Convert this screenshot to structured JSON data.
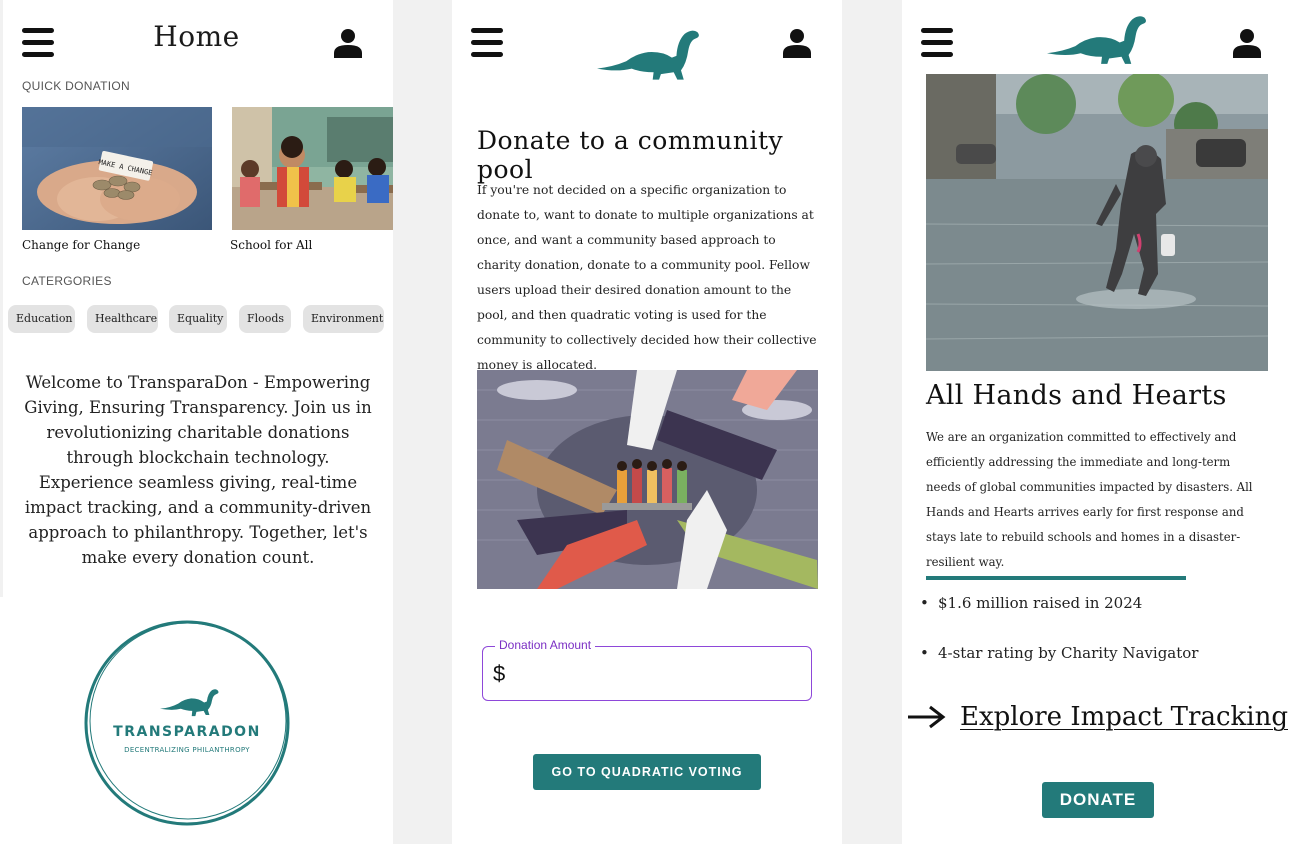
{
  "screen1": {
    "title": "Home",
    "quick_donation_label": "QUICK DONATION",
    "cards": [
      {
        "caption": "Change for Change",
        "note_text": "MAKE A CHANGE"
      },
      {
        "caption": "School for All"
      }
    ],
    "categories_label": "CATERGORIES",
    "categories": [
      "Education",
      "Healthcare",
      "Equality",
      "Floods",
      "Environment"
    ],
    "welcome": "Welcome to TransparaDon - Empowering Giving, Ensuring Transparency. Join us in revolutionizing charitable donations through blockchain technology. Experience seamless giving, real-time impact tracking, and a community-driven approach to philanthropy. Together, let's make every donation count.",
    "logo": {
      "name": "TRANSPARADON",
      "tagline": "DECENTRALIZING PHILANTHROPY"
    }
  },
  "screen2": {
    "title": "Donate to a community pool",
    "body": "If  you're not decided on a specific organization to donate to, want to donate to multiple organizations at once, and want a community based approach to charity donation, donate to a community pool. Fellow users upload their desired donation amount to the pool, and then quadratic voting is used for the community to collectively decided how their collective money is allocated.",
    "donation_field": {
      "label": "Donation Amount",
      "prefix": "$",
      "value": ""
    },
    "button": "GO TO QUADRATIC VOTING"
  },
  "screen3": {
    "title": "All Hands and Hearts",
    "body": "We are an organization committed to effectively and efficiently addressing the immediate and long-term needs of global communities impacted by disasters. All Hands and Hearts arrives early for first response and stays late to rebuild schools and homes in a disaster-resilient way.",
    "stats": [
      "$1.6 million raised in 2024",
      "4-star rating by Charity Navigator"
    ],
    "explore_link": "Explore Impact Tracking",
    "button": "DONATE"
  },
  "colors": {
    "teal": "#237a7a",
    "purple": "#8e48d9",
    "chip_bg": "#e3e3e3"
  },
  "icons": [
    "hamburger-menu-icon",
    "user-profile-icon",
    "dinosaur-logo-icon",
    "right-arrow-icon"
  ]
}
